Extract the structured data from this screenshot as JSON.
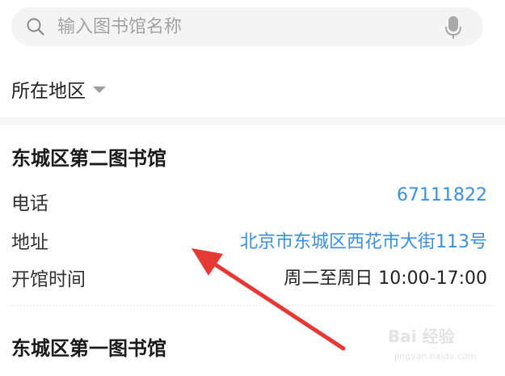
{
  "search": {
    "placeholder": "输入图书馆名称",
    "value": ""
  },
  "icons": {
    "search": "search-icon",
    "voice": "microphone-icon",
    "dropdown": "chevron-down-icon"
  },
  "filter": {
    "region_label": "所在地区"
  },
  "libraries": [
    {
      "name": "东城区第二图书馆",
      "phone_label": "电话",
      "phone": "67111822",
      "address_label": "地址",
      "address": "北京市东城区西花市大街113号",
      "hours_label": "开馆时间",
      "hours": "周二至周日 10:00-17:00"
    },
    {
      "name": "东城区第一图书馆"
    }
  ],
  "watermark": {
    "brand": "Bai 经验",
    "sub": "jingyan.baidu.com"
  },
  "colors": {
    "link": "#3a8fe0",
    "arrow": "#e53935",
    "search_bg": "#f4f4f4",
    "placeholder": "#a3a3a3"
  }
}
